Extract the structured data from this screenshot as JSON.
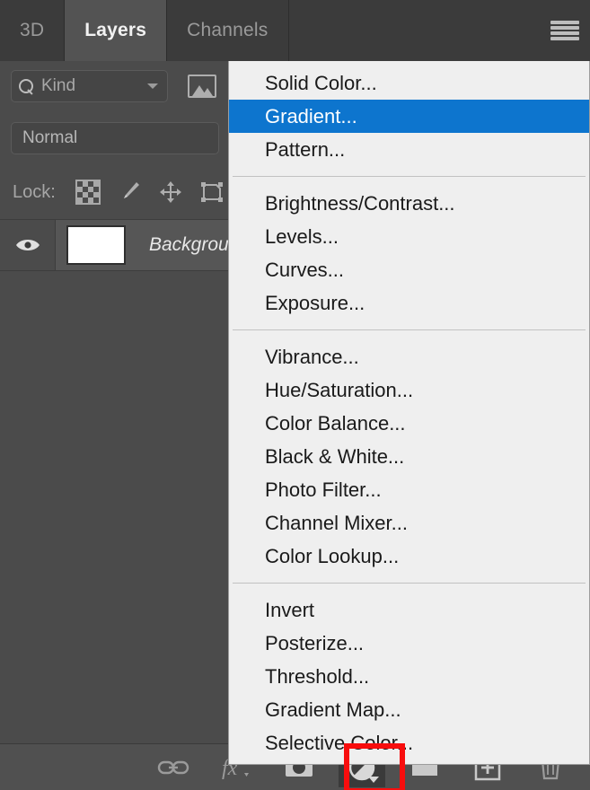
{
  "panel": {
    "tabs": [
      {
        "label": "3D",
        "active": false
      },
      {
        "label": "Layers",
        "active": true
      },
      {
        "label": "Channels",
        "active": false
      }
    ],
    "menu_icon": "hamburger-icon",
    "filter": {
      "search_icon": "search-icon",
      "kind_label": "Kind",
      "chevron_icon": "chevron-down-icon",
      "image_filter_icon": "image-icon"
    },
    "blend_mode": {
      "value": "Normal"
    },
    "lock": {
      "label": "Lock:",
      "icons": [
        {
          "name": "lock-transparent-pixels-icon",
          "title": "checkerboard"
        },
        {
          "name": "lock-image-pixels-icon",
          "title": "paintbrush"
        },
        {
          "name": "lock-position-icon",
          "title": "move-arrows"
        },
        {
          "name": "lock-artboard-nesting-icon",
          "title": "artboard"
        }
      ]
    },
    "layers": [
      {
        "visibility_icon": "eye-icon",
        "thumbnail_color": "#ffffff",
        "name": "Background",
        "italic": true
      }
    ],
    "bottom_toolbar": [
      {
        "name": "link-layers-button",
        "icon": "chain-link-icon",
        "pressed": false
      },
      {
        "name": "layer-style-button",
        "icon": "fx-icon",
        "pressed": false
      },
      {
        "name": "add-layer-mask-button",
        "icon": "layer-mask-icon",
        "pressed": false
      },
      {
        "name": "new-adjustment-layer-button",
        "icon": "half-filled-circle-icon",
        "pressed": true
      },
      {
        "name": "new-group-button",
        "icon": "folder-icon",
        "pressed": false
      },
      {
        "name": "new-layer-button",
        "icon": "plus-square-icon",
        "pressed": false
      },
      {
        "name": "delete-layer-button",
        "icon": "trash-icon",
        "pressed": false
      }
    ]
  },
  "adjustment_menu": {
    "groups": [
      {
        "items": [
          {
            "label": "Solid Color...",
            "selected": false
          },
          {
            "label": "Gradient...",
            "selected": true
          },
          {
            "label": "Pattern...",
            "selected": false
          }
        ]
      },
      {
        "items": [
          {
            "label": "Brightness/Contrast...",
            "selected": false
          },
          {
            "label": "Levels...",
            "selected": false
          },
          {
            "label": "Curves...",
            "selected": false
          },
          {
            "label": "Exposure...",
            "selected": false
          }
        ]
      },
      {
        "items": [
          {
            "label": "Vibrance...",
            "selected": false
          },
          {
            "label": "Hue/Saturation...",
            "selected": false
          },
          {
            "label": "Color Balance...",
            "selected": false
          },
          {
            "label": "Black & White...",
            "selected": false
          },
          {
            "label": "Photo Filter...",
            "selected": false
          },
          {
            "label": "Channel Mixer...",
            "selected": false
          },
          {
            "label": "Color Lookup...",
            "selected": false
          }
        ]
      },
      {
        "items": [
          {
            "label": "Invert",
            "selected": false
          },
          {
            "label": "Posterize...",
            "selected": false
          },
          {
            "label": "Threshold...",
            "selected": false
          },
          {
            "label": "Gradient Map...",
            "selected": false
          },
          {
            "label": "Selective Color...",
            "selected": false
          }
        ]
      }
    ]
  },
  "annotation": {
    "highlight_color": "#f80d0d",
    "target": "new-adjustment-layer-button"
  },
  "colors": {
    "panel_bg": "#4b4b4b",
    "tab_bg": "#3b3b3b",
    "tab_active_bg": "#535353",
    "menu_bg": "#efefef",
    "menu_selected_bg": "#0d75ce",
    "toolbar_bg": "#505050"
  }
}
